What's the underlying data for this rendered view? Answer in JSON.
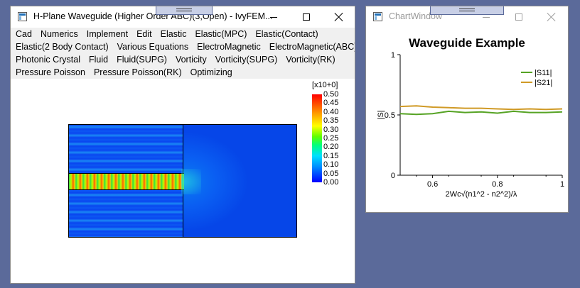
{
  "main_window": {
    "title": "H-Plane Waveguide (Higher Order ABC)(3,Open) - IvyFEM...",
    "menu_rows": [
      [
        "Cad",
        "Numerics",
        "Implement",
        "Edit",
        "Elastic",
        "Elastic(MPC)",
        "Elastic(Contact)"
      ],
      [
        "Elastic(2 Body Contact)",
        "Various Equations",
        "ElectroMagnetic",
        "ElectroMagnetic(ABC)"
      ],
      [
        "Photonic Crystal",
        "Fluid",
        "Fluid(SUPG)",
        "Vorticity",
        "Vorticity(SUPG)",
        "Vorticity(RK)"
      ],
      [
        "Pressure Poisson",
        "Pressure Poisson(RK)",
        "Optimizing"
      ]
    ],
    "colorbar": {
      "header": "[x10+0]",
      "labels": [
        "0.50",
        "0.45",
        "0.40",
        "0.35",
        "0.30",
        "0.25",
        "0.20",
        "0.15",
        "0.10",
        "0.05",
        "0.00"
      ]
    }
  },
  "chart_window": {
    "title": "ChartWindow"
  },
  "chart_data": {
    "type": "line",
    "title": "Waveguide Example",
    "xlabel": "2Wc√(n1^2 - n2^2)/λ",
    "ylabel": "|S|",
    "xlim": [
      0.5,
      1.0
    ],
    "ylim": [
      0,
      1
    ],
    "x_ticks": [
      "0.6",
      "0.8",
      "1"
    ],
    "y_ticks": [
      "0",
      "0.5",
      "1"
    ],
    "legend_position": "top-right",
    "series": [
      {
        "name": "|S11|",
        "color": "#56a324",
        "x": [
          0.5,
          0.55,
          0.6,
          0.65,
          0.7,
          0.75,
          0.8,
          0.85,
          0.9,
          0.95,
          1.0
        ],
        "y": [
          0.51,
          0.505,
          0.51,
          0.53,
          0.52,
          0.525,
          0.515,
          0.53,
          0.52,
          0.52,
          0.525
        ]
      },
      {
        "name": "|S21|",
        "color": "#d09a26",
        "x": [
          0.5,
          0.55,
          0.6,
          0.65,
          0.7,
          0.75,
          0.8,
          0.85,
          0.9,
          0.95,
          1.0
        ],
        "y": [
          0.57,
          0.575,
          0.565,
          0.56,
          0.555,
          0.555,
          0.55,
          0.545,
          0.55,
          0.545,
          0.55
        ]
      }
    ]
  }
}
